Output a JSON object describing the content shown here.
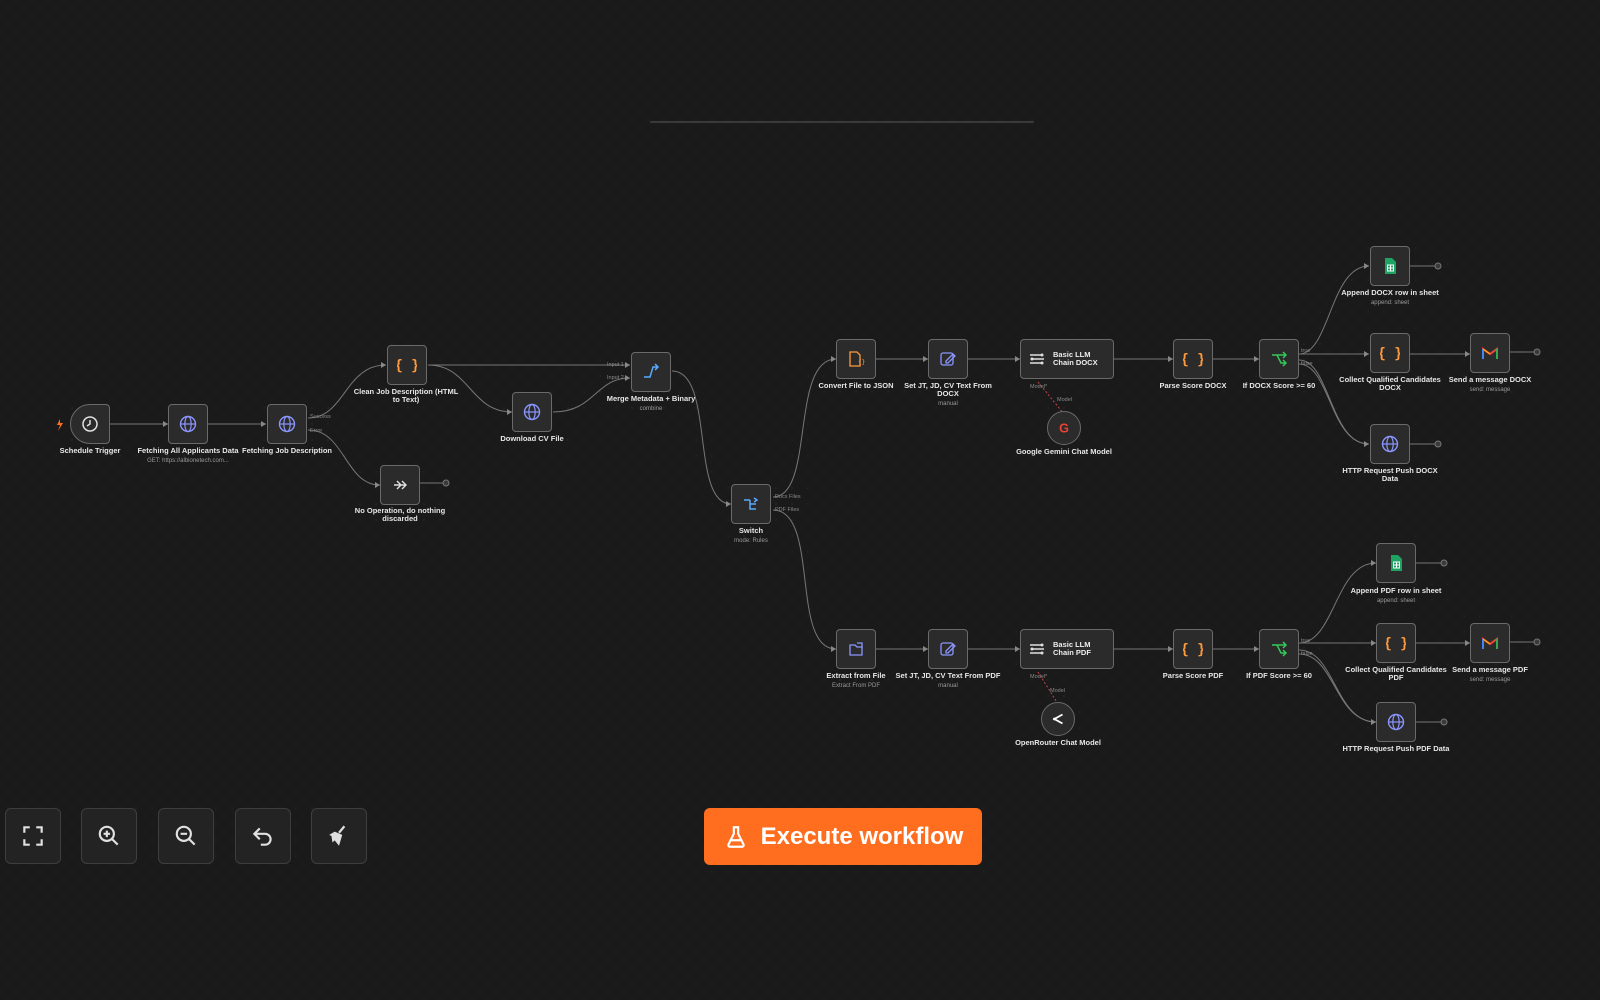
{
  "canvas": {
    "nodes": {
      "schedule_trigger": {
        "title": "Schedule Trigger"
      },
      "fetch_applicants": {
        "title": "Fetching All Applicants Data",
        "subtitle": "GET: https://albionetech.com..."
      },
      "fetch_job": {
        "title": "Fetching Job Description",
        "port_success": "Success",
        "port_error": "Error"
      },
      "clean_job": {
        "title": "Clean Job Description (HTML to Text)"
      },
      "no_op": {
        "title": "No Operation, do nothing discarded"
      },
      "download_cv": {
        "title": "Download CV File"
      },
      "merge": {
        "title": "Merge Metadata + Binary",
        "subtitle": "combine",
        "input1": "Input 1",
        "input2": "Input 2"
      },
      "switch": {
        "title": "Switch",
        "subtitle": "mode: Rules",
        "out_docx": "Docx Files",
        "out_pdf": "PDF Files"
      },
      "convert_json": {
        "title": "Convert File to JSON"
      },
      "set_docx": {
        "title": "Set JT, JD, CV Text From DOCX",
        "subtitle": "manual"
      },
      "llm_docx": {
        "title": "Basic LLM Chain DOCX",
        "port_model": "Model*"
      },
      "gemini": {
        "title": "Google Gemini Chat Model",
        "port": "Model"
      },
      "parse_docx": {
        "title": "Parse Score DOCX"
      },
      "if_docx": {
        "title": "If DOCX Score >= 60",
        "port_true": "true",
        "port_false": "false"
      },
      "append_docx": {
        "title": "Append DOCX row in sheet",
        "subtitle": "append: sheet"
      },
      "collect_docx": {
        "title": "Collect Qualified Candidates DOCX"
      },
      "send_docx": {
        "title": "Send a message DOCX",
        "subtitle": "send: message"
      },
      "http_docx": {
        "title": "HTTP Request Push DOCX Data"
      },
      "extract_file": {
        "title": "Extract from File",
        "subtitle": "Extract From PDF"
      },
      "set_pdf": {
        "title": "Set JT, JD, CV Text From PDF",
        "subtitle": "manual"
      },
      "llm_pdf": {
        "title": "Basic LLM Chain PDF",
        "port_model": "Model*"
      },
      "openrouter": {
        "title": "OpenRouter Chat Model",
        "port": "Model"
      },
      "parse_pdf": {
        "title": "Parse Score PDF"
      },
      "if_pdf": {
        "title": "If PDF Score >= 60",
        "port_true": "true",
        "port_false": "false"
      },
      "append_pdf": {
        "title": "Append PDF row in sheet",
        "subtitle": "append: sheet"
      },
      "collect_pdf": {
        "title": "Collect Qualified Candidates PDF"
      },
      "send_pdf": {
        "title": "Send a message PDF",
        "subtitle": "send: message"
      },
      "http_pdf": {
        "title": "HTTP Request Push PDF Data"
      }
    }
  },
  "toolbar": {
    "buttons": [
      "fit-to-view",
      "zoom-in",
      "zoom-out",
      "undo",
      "tidy-up"
    ],
    "execute_label": "Execute workflow"
  },
  "colors": {
    "accent": "#ff6d1f",
    "canvas": "#1a1a1a",
    "node_bg": "#2b2b2b",
    "icon_blue": "#8b96ff",
    "icon_orange": "#ff9b3d",
    "icon_green": "#34c759",
    "sheets_green": "#1ea362"
  }
}
